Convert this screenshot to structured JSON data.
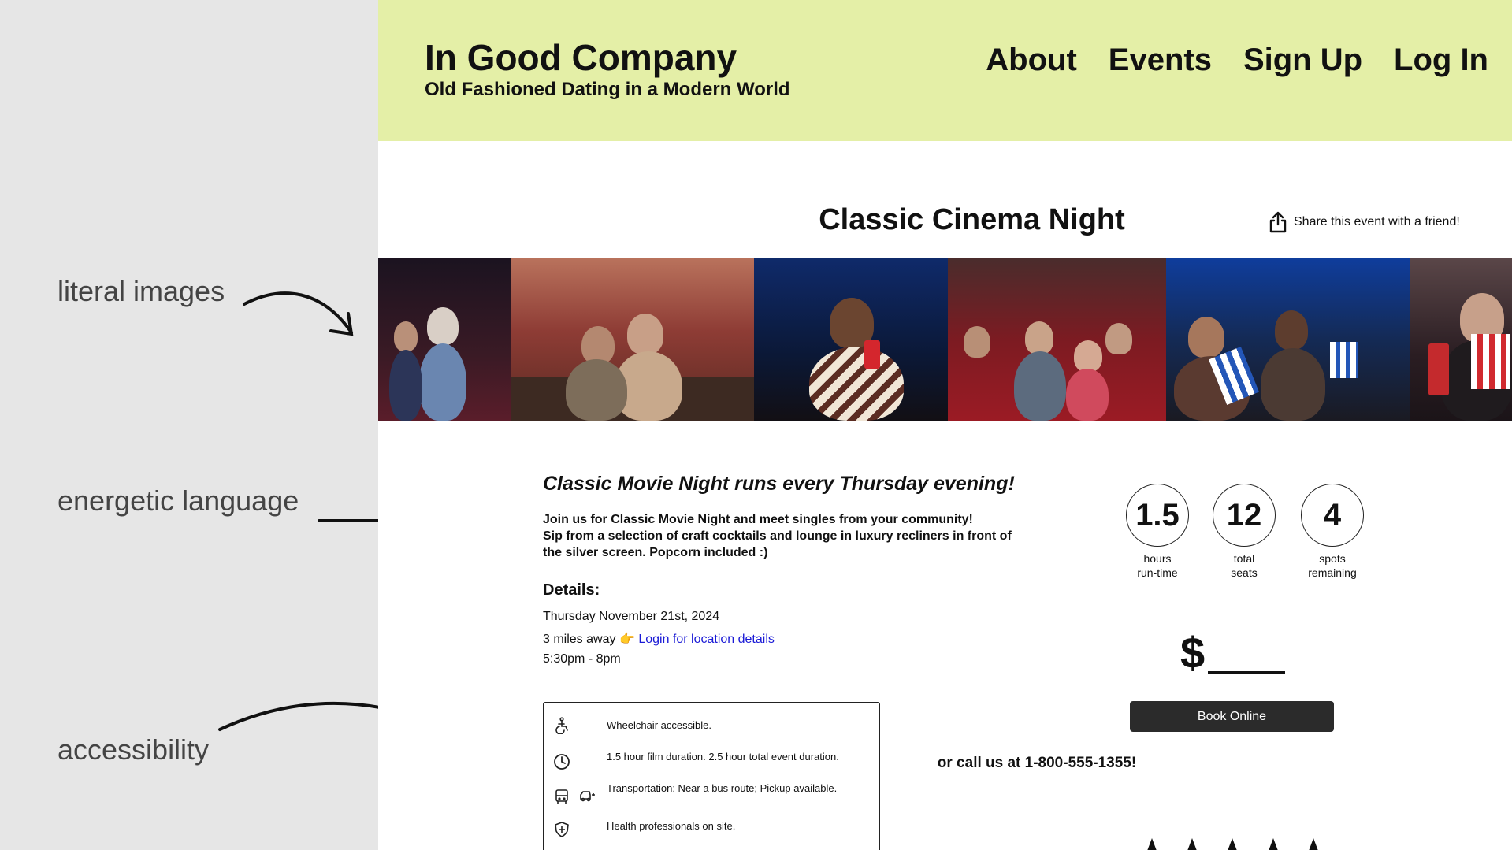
{
  "annotations": {
    "items": [
      {
        "label": "literal images"
      },
      {
        "label": "energetic language"
      },
      {
        "label": "accessibility"
      }
    ]
  },
  "header": {
    "brand_title": "In Good Company",
    "brand_subtitle": "Old Fashioned Dating in a Modern World",
    "nav": [
      "About",
      "Events",
      "Sign Up",
      "Log In"
    ],
    "background_color": "#e4efa7"
  },
  "event": {
    "title": "Classic Cinema Night",
    "share_label": "Share this event with a friend!",
    "tagline": "Classic Movie Night runs every Thursday evening!",
    "description": [
      "Join us for Classic Movie Night and meet singles from your community!",
      "Sip from a selection of craft cocktails and lounge in luxury recliners in front of the silver screen. Popcorn included :)"
    ],
    "details_heading": "Details:",
    "date": "Thursday November 21st, 2024",
    "distance": "3 miles away",
    "distance_emoji": "👉",
    "location_link": "Login for location details",
    "time": "5:30pm - 8pm"
  },
  "accessibility": [
    {
      "icon": "wheelchair-icon",
      "text": "Wheelchair accessible."
    },
    {
      "icon": "clock-icon",
      "text": "1.5 hour film duration. 2.5 hour total event duration."
    },
    {
      "icon": "bus-icon",
      "icon2": "car-icon",
      "text": "Transportation: Near a bus route; Pickup available."
    },
    {
      "icon": "shield-cross-icon",
      "text": "Health professionals on site."
    }
  ],
  "stats": [
    {
      "value": "1.5",
      "label1": "hours",
      "label2": "run-time"
    },
    {
      "value": "12",
      "label1": "total",
      "label2": "seats"
    },
    {
      "value": "4",
      "label1": "spots",
      "label2": "remaining"
    }
  ],
  "pricing": {
    "price_symbol": "$",
    "book_label": "Book Online",
    "call_text": "or call us at 1-800-555-1355!"
  },
  "photos": [
    {
      "name": "photo-couple-dark-theater"
    },
    {
      "name": "photo-couple-red-theater"
    },
    {
      "name": "photo-woman-sunglasses-drink"
    },
    {
      "name": "photo-group-red-seats"
    },
    {
      "name": "photo-group-popcorn"
    },
    {
      "name": "photo-man-popcorn-drink"
    }
  ]
}
